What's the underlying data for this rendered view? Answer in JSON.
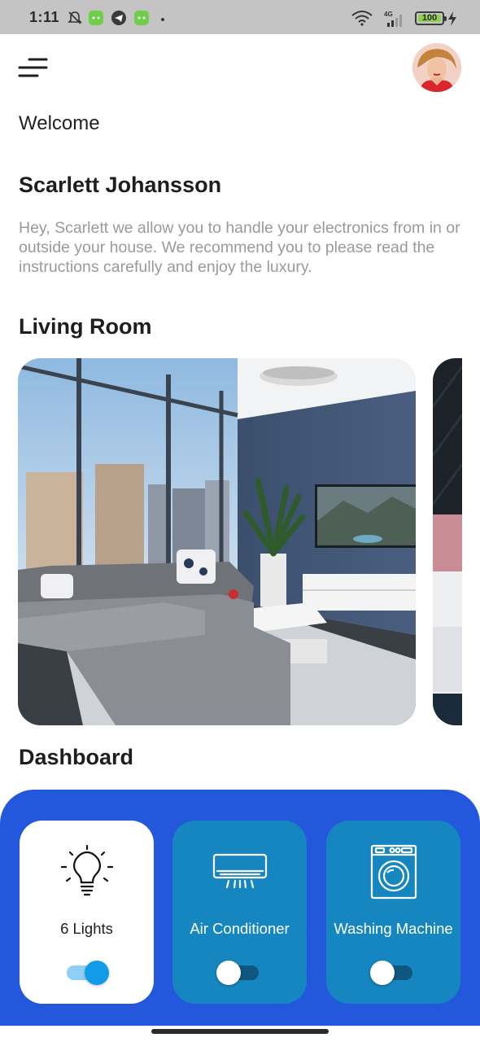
{
  "status_bar": {
    "time": "1:11",
    "battery": "100",
    "network": "4G",
    "icons": [
      "mute-bell-icon",
      "android-app-icon",
      "telegram-icon",
      "android-app-icon",
      "wifi-icon",
      "signal-icon",
      "battery-icon",
      "charging-icon"
    ]
  },
  "header": {
    "menu_icon": "menu-icon",
    "avatar_icon": "user-avatar"
  },
  "welcome": "Welcome",
  "user_name": "Scarlett Johansson",
  "intro": "Hey, Scarlett we allow you to handle your electronics from in or outside your house. We recommend you to please read the instructions carefully and enjoy the luxury.",
  "rooms_section_title": "Living Room",
  "rooms": [
    {
      "image": "living-room-photo"
    },
    {
      "image": "bedroom-photo"
    }
  ],
  "dashboard_title": "Dashboard",
  "dashboard": {
    "accent": "#2358dd",
    "card_color": "#1586bf",
    "devices": [
      {
        "label": "6 Lights",
        "icon": "light-bulb-icon",
        "on": true
      },
      {
        "label": "Air Conditioner",
        "icon": "air-conditioner-icon",
        "on": false
      },
      {
        "label": "Washing Machine",
        "icon": "washing-machine-icon",
        "on": false
      }
    ]
  }
}
